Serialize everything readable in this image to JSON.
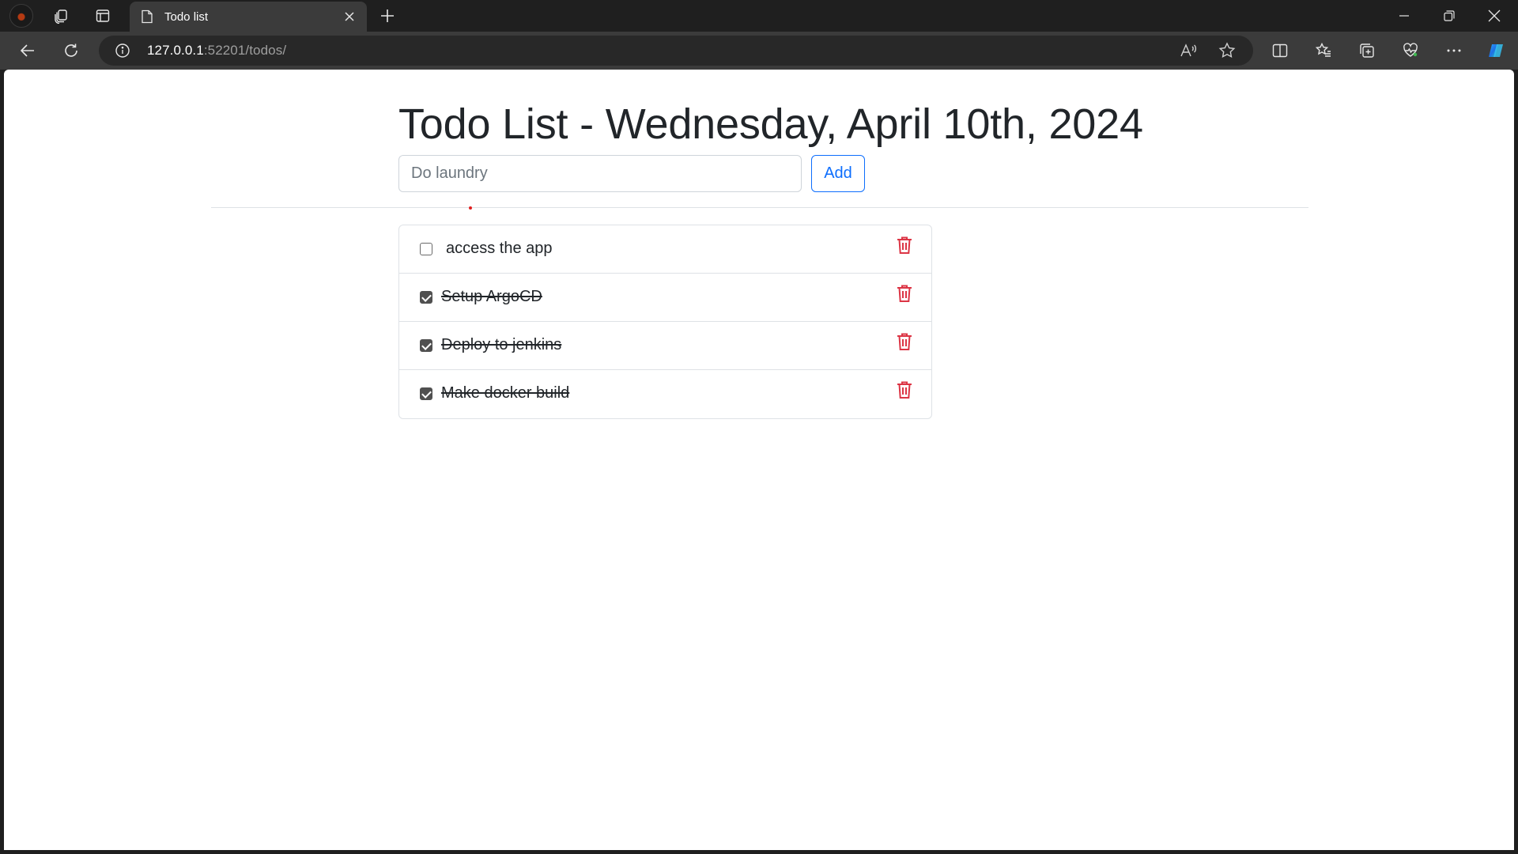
{
  "browser": {
    "tab_title": "Todo list",
    "url_host": "127.0.0.1",
    "url_rest": ":52201/todos/"
  },
  "page": {
    "title": "Todo List - Wednesday, April 10th, 2024",
    "input_placeholder": "Do laundry",
    "add_label": "Add",
    "accent_color": "#0d6efd",
    "delete_color": "#dc3545"
  },
  "todos": [
    {
      "text": "access the app",
      "done": false
    },
    {
      "text": "Setup ArgoCD",
      "done": true
    },
    {
      "text": "Deploy to jenkins",
      "done": true
    },
    {
      "text": "Make docker build",
      "done": true
    }
  ]
}
